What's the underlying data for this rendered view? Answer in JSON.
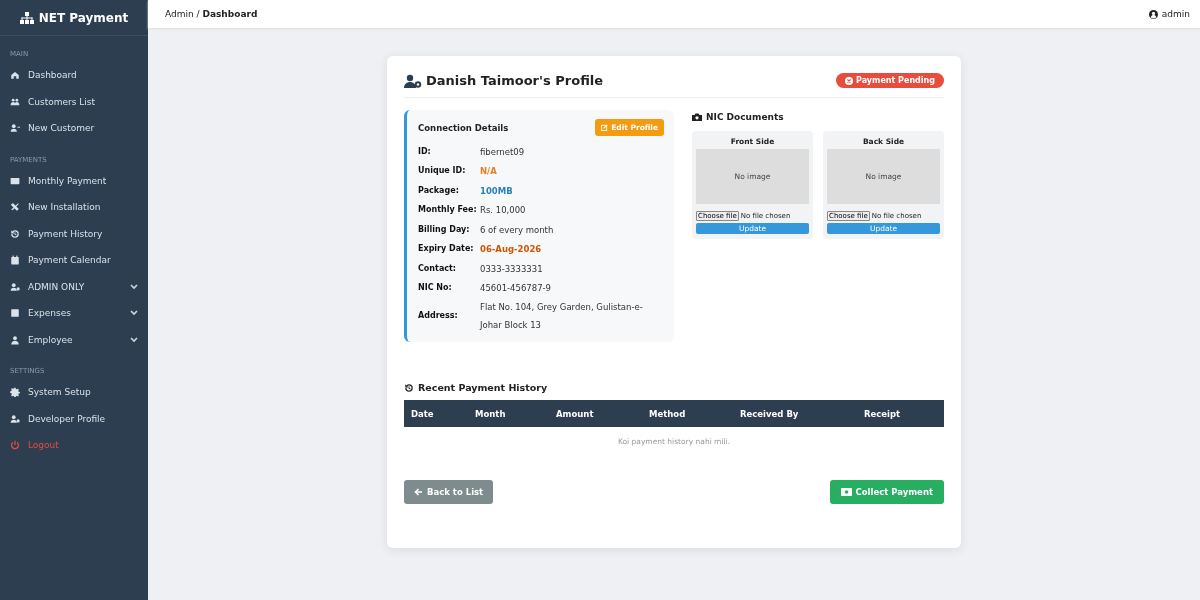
{
  "sidebar": {
    "brand": "NET Payment",
    "items": [
      {
        "kind": "section",
        "label": "MAIN"
      },
      {
        "kind": "item",
        "label": "Dashboard"
      },
      {
        "kind": "item",
        "label": "Customers List"
      },
      {
        "kind": "item",
        "label": "New Customer"
      },
      {
        "kind": "section",
        "label": "PAYMENTS"
      },
      {
        "kind": "item",
        "label": "Monthly Payment"
      },
      {
        "kind": "item",
        "label": "New Installation"
      },
      {
        "kind": "item",
        "label": "Payment History"
      },
      {
        "kind": "item",
        "label": "Payment Calendar"
      },
      {
        "kind": "group",
        "label": "ADMIN ONLY",
        "expanded": false
      },
      {
        "kind": "group",
        "label": "Expenses",
        "expanded": false
      },
      {
        "kind": "group",
        "label": "Employee",
        "expanded": false
      },
      {
        "kind": "section",
        "label": "SETTINGS"
      },
      {
        "kind": "item",
        "label": "System Setup"
      },
      {
        "kind": "item",
        "label": "Developer Profile"
      },
      {
        "kind": "danger",
        "label": "Logout"
      }
    ]
  },
  "topbar": {
    "breadcrumb": [
      "Admin /",
      "Dashboard"
    ],
    "user": "admin"
  },
  "profile": {
    "title": "Danish Taimoor's Profile",
    "status": "Payment Pending",
    "details": {
      "title": "Connection Details",
      "edit_button": "Edit Profile",
      "rows": [
        {
          "label": "ID:",
          "value": "fibernet09",
          "kind": "plain"
        },
        {
          "label": "Unique ID:",
          "value": "N/A",
          "kind": "warning"
        },
        {
          "label": "Package:",
          "value": "100MB",
          "kind": "info"
        },
        {
          "label": "Monthly Fee:",
          "value": "Rs. 10,000",
          "kind": "plain"
        },
        {
          "label": "Billing Day:",
          "value": "6 of every month",
          "kind": "plain"
        },
        {
          "label": "Expiry Date:",
          "value": "06-Aug-2026",
          "kind": "date"
        },
        {
          "label": "Contact:",
          "value": "0333-3333331",
          "kind": "plain"
        },
        {
          "label": "NIC No:",
          "value": "45601-456787-9",
          "kind": "plain"
        },
        {
          "label": "Address:",
          "value": "Flat No. 104, Grey Garden, Gulistan-e-Johar Block 13",
          "kind": "plain"
        }
      ]
    },
    "documents": {
      "title": "NIC Documents",
      "sides": [
        {
          "title": "Front Side",
          "placeholder": "No image",
          "file_button": "Choose file",
          "file_status": "No file chosen",
          "button": "Update"
        },
        {
          "title": "Back Side",
          "placeholder": "No image",
          "file_button": "Choose file",
          "file_status": "No file chosen",
          "button": "Update"
        }
      ]
    },
    "history": {
      "title": "Recent Payment History",
      "columns": [
        "Date",
        "Month",
        "Amount",
        "Method",
        "Received By",
        "Receipt"
      ],
      "empty": "Koi payment history nahi mili."
    },
    "back_button": "Back to List",
    "collect_button": "Collect Payment"
  }
}
